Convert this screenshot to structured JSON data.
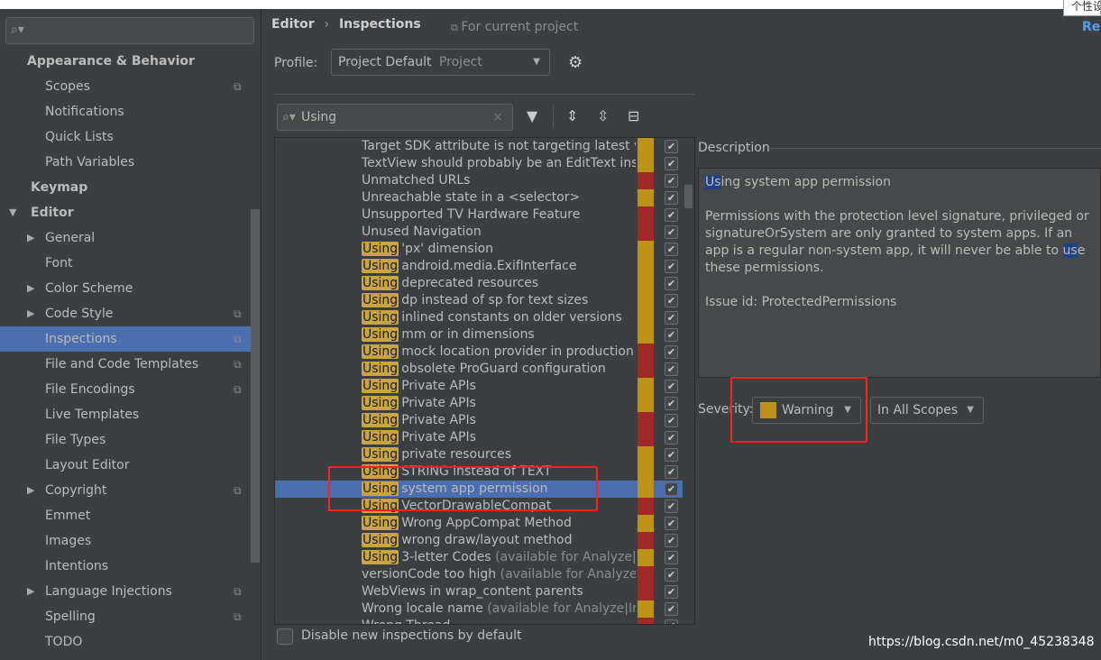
{
  "tooltip": "个性设",
  "sidebar": {
    "search_placeholder": "",
    "items": [
      {
        "label": "Appearance & Behavior",
        "level": 0,
        "bold": true
      },
      {
        "label": "Scopes",
        "level": 1,
        "copy": true
      },
      {
        "label": "Notifications",
        "level": 1
      },
      {
        "label": "Quick Lists",
        "level": 1
      },
      {
        "label": "Path Variables",
        "level": 1
      },
      {
        "label": "Keymap",
        "level": 0,
        "bold": true
      },
      {
        "label": "Editor",
        "level": 0,
        "bold": true,
        "expanded": true
      },
      {
        "label": "General",
        "level": 1,
        "collapsed": true
      },
      {
        "label": "Font",
        "level": 1
      },
      {
        "label": "Color Scheme",
        "level": 1,
        "collapsed": true
      },
      {
        "label": "Code Style",
        "level": 1,
        "collapsed": true,
        "copy": true
      },
      {
        "label": "Inspections",
        "level": 1,
        "copy": true,
        "selected": true
      },
      {
        "label": "File and Code Templates",
        "level": 1,
        "copy": true
      },
      {
        "label": "File Encodings",
        "level": 1,
        "copy": true
      },
      {
        "label": "Live Templates",
        "level": 1
      },
      {
        "label": "File Types",
        "level": 1
      },
      {
        "label": "Layout Editor",
        "level": 1
      },
      {
        "label": "Copyright",
        "level": 1,
        "collapsed": true,
        "copy": true
      },
      {
        "label": "Emmet",
        "level": 1
      },
      {
        "label": "Images",
        "level": 1
      },
      {
        "label": "Intentions",
        "level": 1
      },
      {
        "label": "Language Injections",
        "level": 1,
        "collapsed": true,
        "copy": true
      },
      {
        "label": "Spelling",
        "level": 1,
        "copy": true
      },
      {
        "label": "TODO",
        "level": 1
      }
    ]
  },
  "header": {
    "breadcrumb_parent": "Editor",
    "breadcrumb_sep": "›",
    "breadcrumb_current": "Inspections",
    "scope_note": "For current project",
    "reset_label": "Res"
  },
  "profile": {
    "label": "Profile:",
    "value": "Project Default",
    "value_suffix": "Project"
  },
  "filter": {
    "value": "Using",
    "clear": "×"
  },
  "colors": {
    "warning": "#be9117",
    "error": "#9e2927",
    "selection": "#4b6eaf",
    "highlight": "#c8a542"
  },
  "inspections": [
    {
      "text": "Target SDK attribute is not targeting latest ve",
      "sev": "warning"
    },
    {
      "text": "TextView should probably be an EditText inst",
      "sev": "warning"
    },
    {
      "text": "Unmatched URLs",
      "sev": "error"
    },
    {
      "text": "Unreachable state in a <selector>",
      "sev": "warning"
    },
    {
      "text": "Unsupported TV Hardware Feature",
      "sev": "error"
    },
    {
      "text": "Unused Navigation",
      "sev": "error"
    },
    {
      "match": "Using",
      "text": "'px' dimension",
      "sev": "warning"
    },
    {
      "match": "Using",
      "text": "android.media.ExifInterface",
      "sev": "warning"
    },
    {
      "match": "Using",
      "text": "deprecated resources",
      "sev": "warning"
    },
    {
      "match": "Using",
      "text": "dp instead of sp for text sizes",
      "sev": "warning"
    },
    {
      "match": "Using",
      "text": "inlined constants on older versions",
      "sev": "warning"
    },
    {
      "match": "Using",
      "text": "mm or in dimensions",
      "sev": "warning"
    },
    {
      "match": "Using",
      "text": "mock location provider in production",
      "sev": "error"
    },
    {
      "match": "Using",
      "text": "obsolete ProGuard configuration",
      "sev": "error"
    },
    {
      "match": "Using",
      "text": "Private APIs",
      "sev": "warning"
    },
    {
      "match": "Using",
      "text": "Private APIs",
      "sev": "warning"
    },
    {
      "match": "Using",
      "text": "Private APIs",
      "sev": "error"
    },
    {
      "match": "Using",
      "text": "Private APIs",
      "sev": "error"
    },
    {
      "match": "Using",
      "text": "private resources",
      "sev": "warning"
    },
    {
      "match": "Using",
      "text": "STRING instead of TEXT",
      "sev": "warning"
    },
    {
      "match": "Using",
      "text": "system app permission",
      "sev": "warning",
      "selected": true
    },
    {
      "match": "Using",
      "text": "VectorDrawableCompat",
      "sev": "error"
    },
    {
      "match": "Using",
      "text": "Wrong AppCompat Method",
      "sev": "warning"
    },
    {
      "match": "Using",
      "text": "wrong draw/layout method",
      "sev": "error"
    },
    {
      "match": "Using",
      "text": "3-letter Codes",
      "note": "(available for Analyze|In",
      "sev": "warning"
    },
    {
      "text": "versionCode too high",
      "note": "(available for Analyze|I",
      "sev": "error"
    },
    {
      "text": "WebViews in wrap_content parents",
      "sev": "error"
    },
    {
      "text": "Wrong locale name",
      "note": "(available for Analyze|Ins",
      "sev": "warning"
    },
    {
      "text": "Wrong Thread",
      "sev": "error"
    }
  ],
  "disable_new": {
    "label": "Disable new inspections by default",
    "checked": false
  },
  "description": {
    "title": "Description",
    "heading_match": "Us",
    "heading_rest": "ing system app permission",
    "body_1": "Permissions with the protection level signature, privileged or signatureOrSystem are only granted to system apps. If an app is a regular non-system app, it will never be able to ",
    "body_match": "us",
    "body_2": "e these permissions.",
    "issue": "Issue id: ProtectedPermissions"
  },
  "severity": {
    "label": "Severity:",
    "value": "Warning",
    "scope": "In All Scopes"
  },
  "watermark": "https://blog.csdn.net/m0_45238348"
}
